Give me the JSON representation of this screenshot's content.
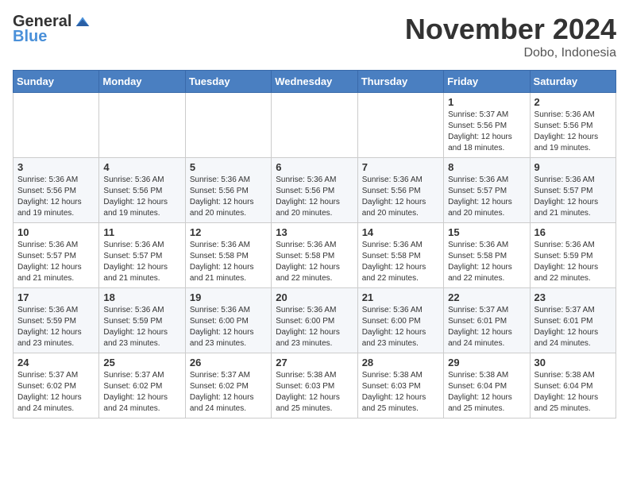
{
  "header": {
    "logo_general": "General",
    "logo_blue": "Blue",
    "month": "November 2024",
    "location": "Dobo, Indonesia"
  },
  "weekdays": [
    "Sunday",
    "Monday",
    "Tuesday",
    "Wednesday",
    "Thursday",
    "Friday",
    "Saturday"
  ],
  "weeks": [
    [
      {
        "day": "",
        "info": ""
      },
      {
        "day": "",
        "info": ""
      },
      {
        "day": "",
        "info": ""
      },
      {
        "day": "",
        "info": ""
      },
      {
        "day": "",
        "info": ""
      },
      {
        "day": "1",
        "info": "Sunrise: 5:37 AM\nSunset: 5:56 PM\nDaylight: 12 hours and 18 minutes."
      },
      {
        "day": "2",
        "info": "Sunrise: 5:36 AM\nSunset: 5:56 PM\nDaylight: 12 hours and 19 minutes."
      }
    ],
    [
      {
        "day": "3",
        "info": "Sunrise: 5:36 AM\nSunset: 5:56 PM\nDaylight: 12 hours and 19 minutes."
      },
      {
        "day": "4",
        "info": "Sunrise: 5:36 AM\nSunset: 5:56 PM\nDaylight: 12 hours and 19 minutes."
      },
      {
        "day": "5",
        "info": "Sunrise: 5:36 AM\nSunset: 5:56 PM\nDaylight: 12 hours and 20 minutes."
      },
      {
        "day": "6",
        "info": "Sunrise: 5:36 AM\nSunset: 5:56 PM\nDaylight: 12 hours and 20 minutes."
      },
      {
        "day": "7",
        "info": "Sunrise: 5:36 AM\nSunset: 5:56 PM\nDaylight: 12 hours and 20 minutes."
      },
      {
        "day": "8",
        "info": "Sunrise: 5:36 AM\nSunset: 5:57 PM\nDaylight: 12 hours and 20 minutes."
      },
      {
        "day": "9",
        "info": "Sunrise: 5:36 AM\nSunset: 5:57 PM\nDaylight: 12 hours and 21 minutes."
      }
    ],
    [
      {
        "day": "10",
        "info": "Sunrise: 5:36 AM\nSunset: 5:57 PM\nDaylight: 12 hours and 21 minutes."
      },
      {
        "day": "11",
        "info": "Sunrise: 5:36 AM\nSunset: 5:57 PM\nDaylight: 12 hours and 21 minutes."
      },
      {
        "day": "12",
        "info": "Sunrise: 5:36 AM\nSunset: 5:58 PM\nDaylight: 12 hours and 21 minutes."
      },
      {
        "day": "13",
        "info": "Sunrise: 5:36 AM\nSunset: 5:58 PM\nDaylight: 12 hours and 22 minutes."
      },
      {
        "day": "14",
        "info": "Sunrise: 5:36 AM\nSunset: 5:58 PM\nDaylight: 12 hours and 22 minutes."
      },
      {
        "day": "15",
        "info": "Sunrise: 5:36 AM\nSunset: 5:58 PM\nDaylight: 12 hours and 22 minutes."
      },
      {
        "day": "16",
        "info": "Sunrise: 5:36 AM\nSunset: 5:59 PM\nDaylight: 12 hours and 22 minutes."
      }
    ],
    [
      {
        "day": "17",
        "info": "Sunrise: 5:36 AM\nSunset: 5:59 PM\nDaylight: 12 hours and 23 minutes."
      },
      {
        "day": "18",
        "info": "Sunrise: 5:36 AM\nSunset: 5:59 PM\nDaylight: 12 hours and 23 minutes."
      },
      {
        "day": "19",
        "info": "Sunrise: 5:36 AM\nSunset: 6:00 PM\nDaylight: 12 hours and 23 minutes."
      },
      {
        "day": "20",
        "info": "Sunrise: 5:36 AM\nSunset: 6:00 PM\nDaylight: 12 hours and 23 minutes."
      },
      {
        "day": "21",
        "info": "Sunrise: 5:36 AM\nSunset: 6:00 PM\nDaylight: 12 hours and 23 minutes."
      },
      {
        "day": "22",
        "info": "Sunrise: 5:37 AM\nSunset: 6:01 PM\nDaylight: 12 hours and 24 minutes."
      },
      {
        "day": "23",
        "info": "Sunrise: 5:37 AM\nSunset: 6:01 PM\nDaylight: 12 hours and 24 minutes."
      }
    ],
    [
      {
        "day": "24",
        "info": "Sunrise: 5:37 AM\nSunset: 6:02 PM\nDaylight: 12 hours and 24 minutes."
      },
      {
        "day": "25",
        "info": "Sunrise: 5:37 AM\nSunset: 6:02 PM\nDaylight: 12 hours and 24 minutes."
      },
      {
        "day": "26",
        "info": "Sunrise: 5:37 AM\nSunset: 6:02 PM\nDaylight: 12 hours and 24 minutes."
      },
      {
        "day": "27",
        "info": "Sunrise: 5:38 AM\nSunset: 6:03 PM\nDaylight: 12 hours and 25 minutes."
      },
      {
        "day": "28",
        "info": "Sunrise: 5:38 AM\nSunset: 6:03 PM\nDaylight: 12 hours and 25 minutes."
      },
      {
        "day": "29",
        "info": "Sunrise: 5:38 AM\nSunset: 6:04 PM\nDaylight: 12 hours and 25 minutes."
      },
      {
        "day": "30",
        "info": "Sunrise: 5:38 AM\nSunset: 6:04 PM\nDaylight: 12 hours and 25 minutes."
      }
    ]
  ]
}
